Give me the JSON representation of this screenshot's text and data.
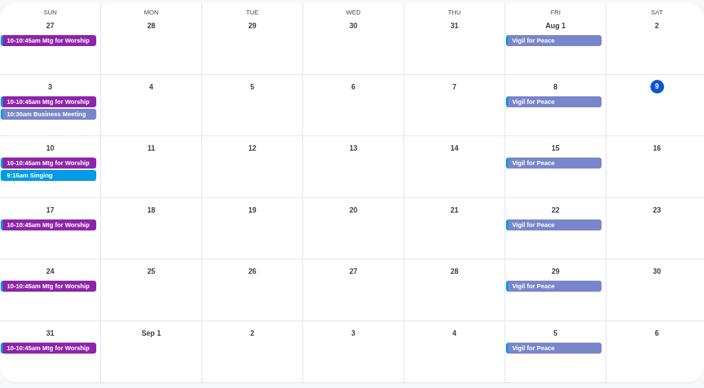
{
  "weekdays": [
    "SUN",
    "MON",
    "TUE",
    "WED",
    "THU",
    "FRI",
    "SAT"
  ],
  "weeks": [
    {
      "days": [
        {
          "date": "27",
          "today": false,
          "events": [
            {
              "title": "10-10:45am Mtg for Worship",
              "color": "#8e24aa"
            }
          ]
        },
        {
          "date": "28",
          "today": false
        },
        {
          "date": "29",
          "today": false
        },
        {
          "date": "30",
          "today": false
        },
        {
          "date": "31",
          "today": false
        },
        {
          "date": "Aug 1",
          "today": false,
          "events": [
            {
              "title": "Vigil for Peace",
              "color": "#7986cb"
            }
          ]
        },
        {
          "date": "2",
          "today": false
        }
      ]
    },
    {
      "days": [
        {
          "date": "3",
          "today": false,
          "events": [
            {
              "title": "10-10:45am Mtg for Worship",
              "color": "#8e24aa"
            },
            {
              "title": "10:30am Business Meeting",
              "color": "#7986cb"
            }
          ]
        },
        {
          "date": "4",
          "today": false
        },
        {
          "date": "5",
          "today": false
        },
        {
          "date": "6",
          "today": false
        },
        {
          "date": "7",
          "today": false
        },
        {
          "date": "8",
          "today": false,
          "events": [
            {
              "title": "Vigil for Peace",
              "color": "#7986cb"
            }
          ]
        },
        {
          "date": "9",
          "today": true
        }
      ]
    },
    {
      "days": [
        {
          "date": "10",
          "today": false,
          "events": [
            {
              "title": "10-10:45am Mtg for Worship",
              "color": "#8e24aa"
            },
            {
              "title": "9:15am Singing",
              "color": "#039be5"
            }
          ]
        },
        {
          "date": "11",
          "today": false
        },
        {
          "date": "12",
          "today": false
        },
        {
          "date": "13",
          "today": false
        },
        {
          "date": "14",
          "today": false
        },
        {
          "date": "15",
          "today": false,
          "events": [
            {
              "title": "Vigil for Peace",
              "color": "#7986cb"
            }
          ]
        },
        {
          "date": "16",
          "today": false
        }
      ]
    },
    {
      "days": [
        {
          "date": "17",
          "today": false,
          "events": [
            {
              "title": "10-10:45am Mtg for Worship",
              "color": "#8e24aa"
            }
          ]
        },
        {
          "date": "18",
          "today": false
        },
        {
          "date": "19",
          "today": false
        },
        {
          "date": "20",
          "today": false
        },
        {
          "date": "21",
          "today": false
        },
        {
          "date": "22",
          "today": false,
          "events": [
            {
              "title": "Vigil for Peace",
              "color": "#7986cb"
            }
          ]
        },
        {
          "date": "23",
          "today": false
        }
      ]
    },
    {
      "days": [
        {
          "date": "24",
          "today": false,
          "events": [
            {
              "title": "10-10:45am Mtg for Worship",
              "color": "#8e24aa"
            }
          ]
        },
        {
          "date": "25",
          "today": false
        },
        {
          "date": "26",
          "today": false
        },
        {
          "date": "27",
          "today": false
        },
        {
          "date": "28",
          "today": false
        },
        {
          "date": "29",
          "today": false,
          "events": [
            {
              "title": "Vigil for Peace",
              "color": "#7986cb"
            }
          ]
        },
        {
          "date": "30",
          "today": false
        }
      ]
    },
    {
      "days": [
        {
          "date": "31",
          "today": false,
          "events": [
            {
              "title": "10-10:45am Mtg for Worship",
              "color": "#8e24aa"
            }
          ]
        },
        {
          "date": "Sep 1",
          "today": false
        },
        {
          "date": "2",
          "today": false
        },
        {
          "date": "3",
          "today": false
        },
        {
          "date": "4",
          "today": false
        },
        {
          "date": "5",
          "today": false,
          "events": [
            {
              "title": "Vigil for Peace",
              "color": "#7986cb"
            }
          ]
        },
        {
          "date": "6",
          "today": false
        }
      ]
    }
  ]
}
